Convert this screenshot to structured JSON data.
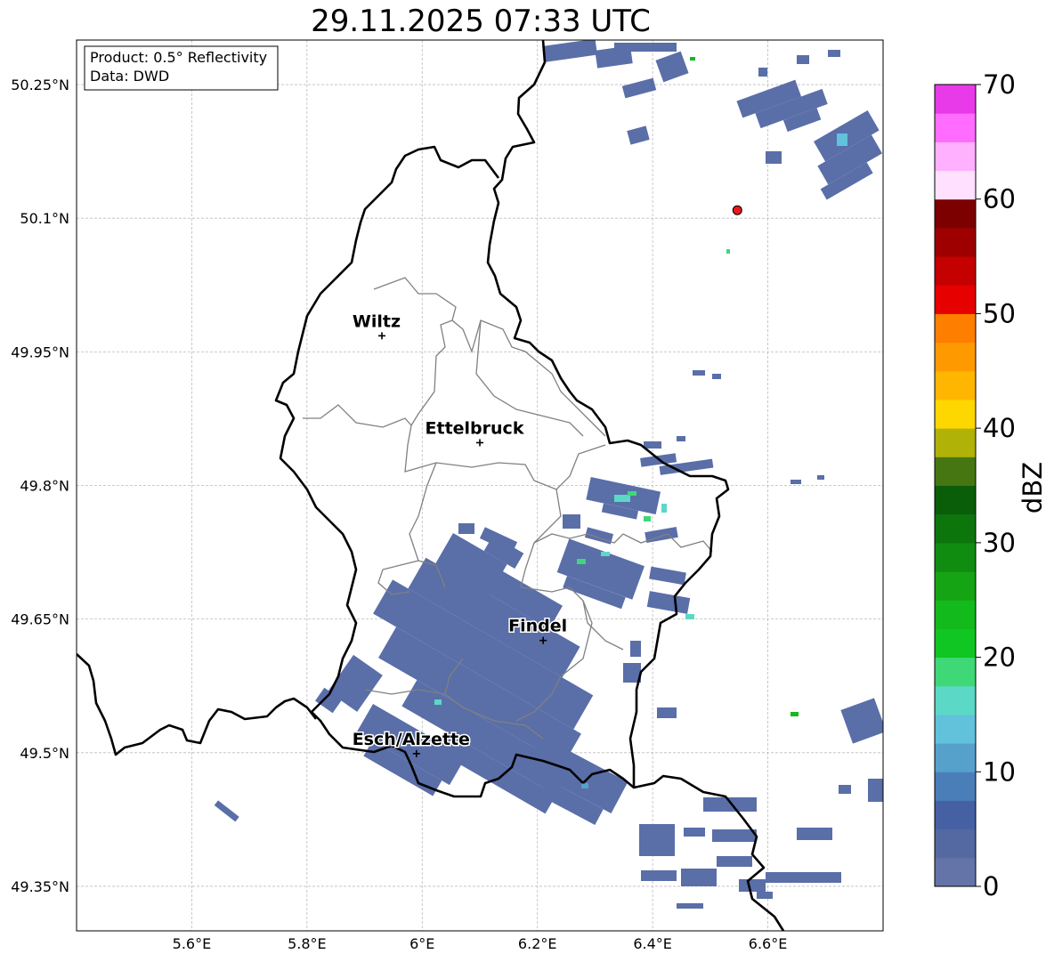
{
  "title": "29.11.2025 07:33 UTC",
  "info": {
    "product": "Product: 0.5° Reflectivity",
    "data_source": "Data: DWD"
  },
  "axes": {
    "x_ticks": [
      "5.6°E",
      "5.8°E",
      "6°E",
      "6.2°E",
      "6.4°E",
      "6.6°E"
    ],
    "y_ticks": [
      "50.25°N",
      "50.1°N",
      "49.95°N",
      "49.8°N",
      "49.65°N",
      "49.5°N",
      "49.35°N"
    ],
    "x_values": [
      5.6,
      5.8,
      6.0,
      6.2,
      6.4,
      6.6
    ],
    "y_values": [
      50.25,
      50.1,
      49.95,
      49.8,
      49.65,
      49.5,
      49.35
    ],
    "lon_range": [
      5.4,
      6.8
    ],
    "lat_range": [
      49.3,
      50.3
    ]
  },
  "cities": [
    {
      "name": "Wiltz",
      "lon": 5.93,
      "lat": 49.968
    },
    {
      "name": "Ettelbruck",
      "lon": 6.1,
      "lat": 49.848
    },
    {
      "name": "Findel",
      "lon": 6.21,
      "lat": 49.626
    },
    {
      "name": "Esch/Alzette",
      "lon": 5.99,
      "lat": 49.499
    }
  ],
  "radar_site": {
    "lon": 6.547,
    "lat": 50.109,
    "color": "#e8191f"
  },
  "colorbar": {
    "label": "dBZ",
    "ticks": [
      "0",
      "10",
      "20",
      "30",
      "40",
      "50",
      "60",
      "70"
    ],
    "colors": [
      "#6474a8",
      "#5468a2",
      "#4660a4",
      "#4a7eb8",
      "#56a0cc",
      "#62c2dc",
      "#5cd8c6",
      "#3ed876",
      "#10c622",
      "#12ba1c",
      "#14a414",
      "#108c10",
      "#0c760c",
      "#0a5e0a",
      "#467612",
      "#b0b208",
      "#fed600",
      "#feb600",
      "#fe9a00",
      "#fe7e00",
      "#e60000",
      "#c40000",
      "#9e0000",
      "#7c0000",
      "#ffe0ff",
      "#ffb0ff",
      "#ff6cff",
      "#e83ae8"
    ]
  }
}
